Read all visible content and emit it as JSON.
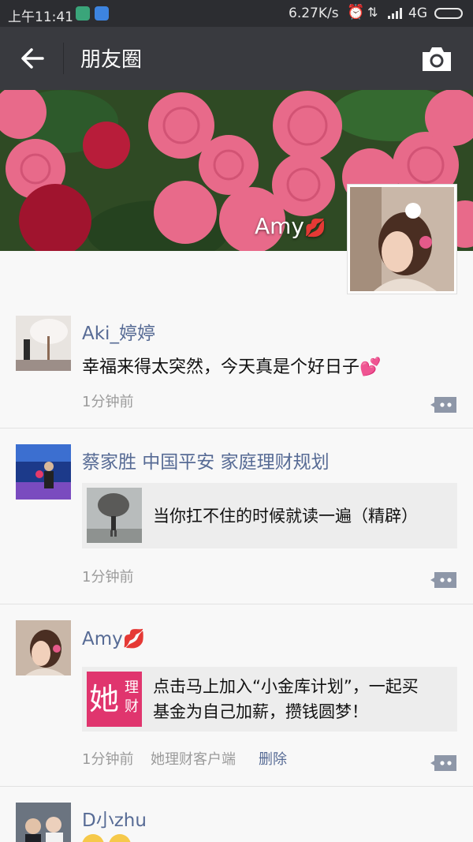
{
  "status_bar": {
    "time": "上午11:41",
    "speed": "6.27K/s",
    "network": "4G"
  },
  "header": {
    "title": "朋友圈",
    "back_icon": "arrow-left-icon",
    "camera_icon": "camera-icon"
  },
  "cover": {
    "name": "Amy",
    "name_emoji": "💋"
  },
  "posts": [
    {
      "name": "Aki_婷婷",
      "text": "幸福来得太突然，今天真是个好日子💕",
      "time": "1分钟前"
    },
    {
      "name": "蔡家胜 中国平安 家庭理财规划",
      "share_title": "当你扛不住的时候就读一遍（精辟）",
      "time": "1分钟前"
    },
    {
      "name": "Amy",
      "name_emoji": "💋",
      "share_title_line1": "点击马上加入“小金库计划”，一起买",
      "share_title_line2": "基金为自己加薪，攒钱圆梦！",
      "share_logo_main": "她",
      "share_logo_top": "理",
      "share_logo_bottom": "财",
      "time": "1分钟前",
      "source": "她理财客户端",
      "delete_label": "删除"
    },
    {
      "name": "D小zhu"
    }
  ],
  "colors": {
    "nav_bg": "#393a3f",
    "status_bg": "#2c2d31",
    "link": "#576b95",
    "share_bg": "#ededed"
  }
}
